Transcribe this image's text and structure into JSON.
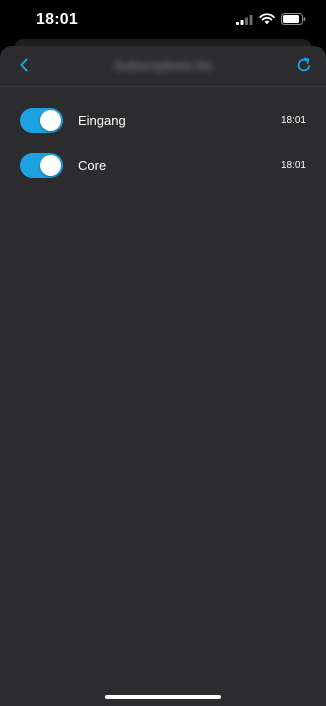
{
  "status_bar": {
    "time": "18:01",
    "icons": [
      "signal-icon",
      "wifi-icon",
      "battery-icon"
    ]
  },
  "nav": {
    "title": "Subscriptions list",
    "back_icon": "chevron-left-icon",
    "refresh_icon": "refresh-icon"
  },
  "colors": {
    "accent": "#1da1e0",
    "background": "#2c2c2e",
    "screen": "#000000"
  },
  "items": [
    {
      "label": "Eingang",
      "time": "18:01",
      "enabled": true
    },
    {
      "label": "Core",
      "time": "18:01",
      "enabled": true
    }
  ]
}
